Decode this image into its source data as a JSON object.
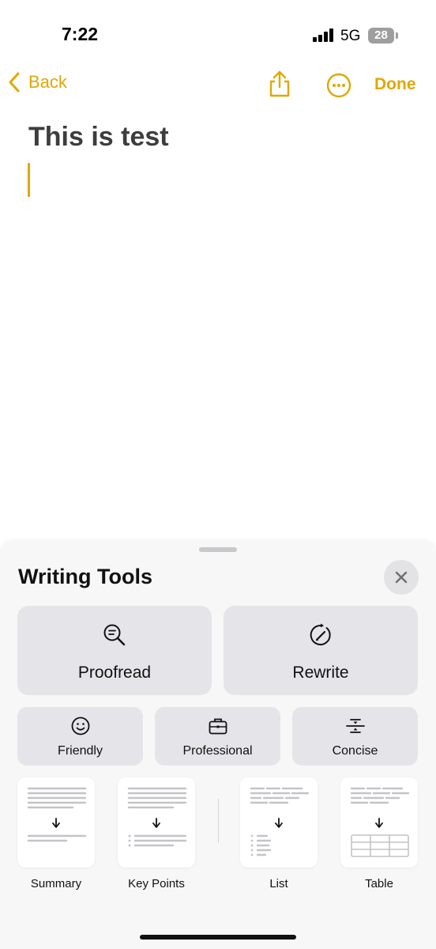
{
  "status_bar": {
    "time": "7:22",
    "network": "5G",
    "battery": "28"
  },
  "nav": {
    "back_label": "Back",
    "done_label": "Done",
    "icons": [
      "chevron-left-icon",
      "share-icon",
      "more-icon"
    ],
    "accent_color": "#e0a800"
  },
  "note": {
    "title": "This is test"
  },
  "writing_tools": {
    "title": "Writing Tools",
    "primary_actions": [
      {
        "label": "Proofread",
        "icon": "proofread-icon"
      },
      {
        "label": "Rewrite",
        "icon": "rewrite-icon"
      }
    ],
    "tone_actions": [
      {
        "label": "Friendly",
        "icon": "smiley-icon"
      },
      {
        "label": "Professional",
        "icon": "briefcase-icon"
      },
      {
        "label": "Concise",
        "icon": "compress-icon"
      }
    ],
    "format_actions": [
      {
        "label": "Summary",
        "icon": "summary-thumbnail"
      },
      {
        "label": "Key Points",
        "icon": "key-points-thumbnail"
      },
      {
        "label": "List",
        "icon": "list-thumbnail"
      },
      {
        "label": "Table",
        "icon": "table-thumbnail"
      }
    ]
  }
}
